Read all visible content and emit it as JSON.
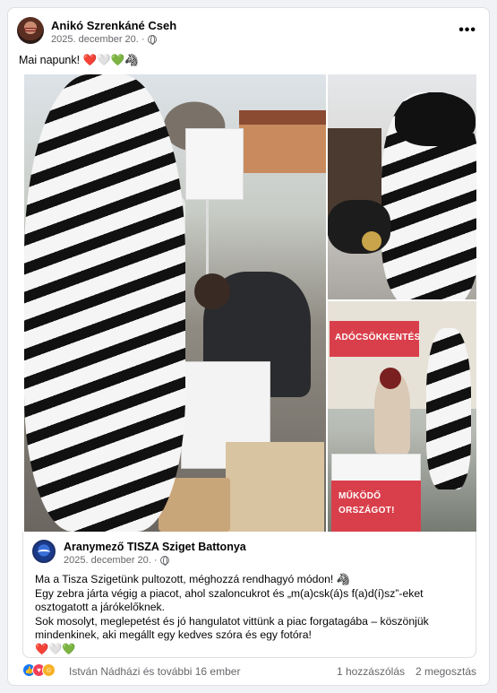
{
  "post": {
    "author": "Anikó Szrenkáné Cseh",
    "date": "2025. december 20. ·",
    "text": "Mai napunk!",
    "text_emojis": "❤️🤍💚🦓"
  },
  "photos": {
    "sign_adocsokkentes": "ADÓCSÖKKENTÉS",
    "sign_mukodo": "MŰKÖDŐ",
    "sign_orszagot": "ORSZÁGOT!"
  },
  "shared_post": {
    "page_name": "Aranymező TISZA Sziget Battonya",
    "date": "2025. december 20. ·",
    "lines": [
      "Ma a Tisza Szigetünk pultozott, méghozzá rendhagyó módon! 🦓",
      "Egy zebra járta végig a piacot, ahol szaloncukrot és „m(a)csk(á)s f(a)d(í)sz”-eket osztogatott a járókelőknek.",
      "Sok mosolyt, meglepetést és jó hangulatot vittünk a piac forgatagába – köszönjük mindenkinek, aki megállt egy kedves szóra és egy fotóra!",
      "❤️🤍💚"
    ]
  },
  "footer": {
    "reaction_names": "István Nádházi és további 16 ember",
    "comments": "1 hozzászólás",
    "shares": "2 megosztás"
  },
  "colors": {
    "link_blue": "#1877f2",
    "secondary_text": "#65676b",
    "sign_red": "#d93f4b"
  },
  "icons": [
    "globe-icon",
    "more-options-icon",
    "like-reaction-icon",
    "love-reaction-icon",
    "care-reaction-icon"
  ]
}
